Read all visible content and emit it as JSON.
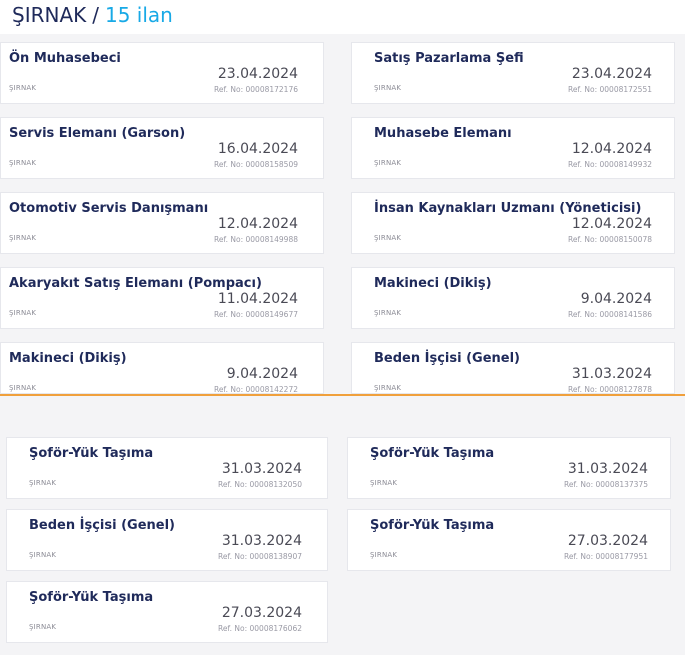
{
  "header": {
    "city": "ŞIRNAK",
    "separator": "/",
    "count": "15 ilan"
  },
  "jobs": [
    {
      "title": "Ön Muhasebeci",
      "city": "ŞIRNAK",
      "date": "23.04.2024",
      "ref": "Ref. No: 00008172176"
    },
    {
      "title": "Satış Pazarlama Şefi",
      "city": "ŞIRNAK",
      "date": "23.04.2024",
      "ref": "Ref. No: 00008172551"
    },
    {
      "title": "Servis Elemanı (Garson)",
      "city": "ŞIRNAK",
      "date": "16.04.2024",
      "ref": "Ref. No: 00008158509"
    },
    {
      "title": "Muhasebe Elemanı",
      "city": "ŞIRNAK",
      "date": "12.04.2024",
      "ref": "Ref. No: 00008149932"
    },
    {
      "title": "Otomotiv Servis Danışmanı",
      "city": "ŞIRNAK",
      "date": "12.04.2024",
      "ref": "Ref. No: 00008149988"
    },
    {
      "title": "İnsan Kaynakları Uzmanı (Yöneticisi)",
      "city": "ŞIRNAK",
      "date": "12.04.2024",
      "ref": "Ref. No: 00008150078"
    },
    {
      "title": "Akaryakıt Satış Elemanı (Pompacı)",
      "city": "ŞIRNAK",
      "date": "11.04.2024",
      "ref": "Ref. No: 00008149677"
    },
    {
      "title": "Makineci (Dikiş)",
      "city": "ŞIRNAK",
      "date": "9.04.2024",
      "ref": "Ref. No: 00008141586"
    },
    {
      "title": "Makineci (Dikiş)",
      "city": "ŞIRNAK",
      "date": "9.04.2024",
      "ref": "Ref. No: 00008142272"
    },
    {
      "title": "Beden İşçisi (Genel)",
      "city": "ŞIRNAK",
      "date": "31.03.2024",
      "ref": "Ref. No: 00008127878"
    },
    {
      "title": "Şoför-Yük Taşıma",
      "city": "ŞIRNAK",
      "date": "31.03.2024",
      "ref": "Ref. No: 00008132050"
    },
    {
      "title": "Şoför-Yük Taşıma",
      "city": "ŞIRNAK",
      "date": "31.03.2024",
      "ref": "Ref. No: 00008137375"
    },
    {
      "title": "Beden İşçisi (Genel)",
      "city": "ŞIRNAK",
      "date": "31.03.2024",
      "ref": "Ref. No: 00008138907"
    },
    {
      "title": "Şoför-Yük Taşıma",
      "city": "ŞIRNAK",
      "date": "27.03.2024",
      "ref": "Ref. No: 00008177951"
    },
    {
      "title": "Şoför-Yük Taşıma",
      "city": "ŞIRNAK",
      "date": "27.03.2024",
      "ref": "Ref. No: 00008176062"
    }
  ],
  "colors": {
    "title": "#1f2a5a",
    "accent": "#18a9e6",
    "divider": "#f0a03c"
  }
}
